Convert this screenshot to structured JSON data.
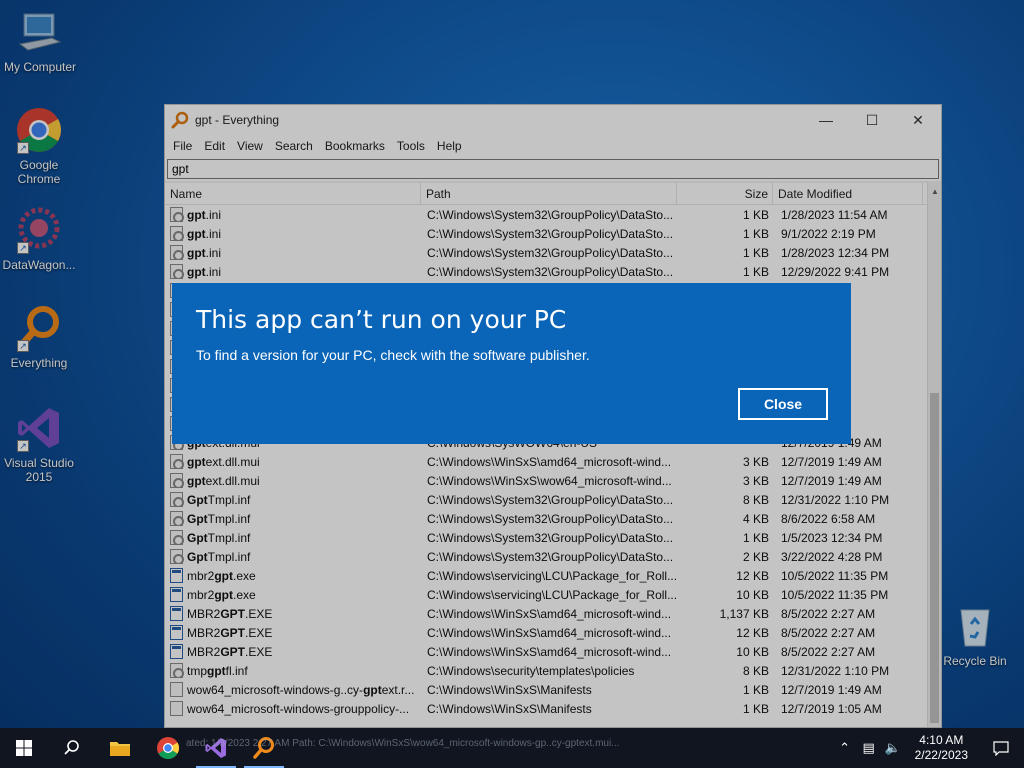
{
  "desktop": {
    "icons": [
      {
        "label": "My Computer"
      },
      {
        "label": "Google Chrome"
      },
      {
        "label": "DataWagon..."
      },
      {
        "label": "Everything"
      },
      {
        "label": "Visual Studio 2015"
      },
      {
        "label": "Recycle Bin"
      }
    ]
  },
  "window": {
    "title": "gpt - Everything",
    "menu": [
      "File",
      "Edit",
      "View",
      "Search",
      "Bookmarks",
      "Tools",
      "Help"
    ],
    "search_value": "gpt",
    "columns": {
      "name": "Name",
      "path": "Path",
      "size": "Size",
      "date": "Date Modified"
    },
    "rows": [
      {
        "pre": "",
        "bold": "gpt",
        "post": ".ini",
        "icon": "gear",
        "path": "C:\\Windows\\System32\\GroupPolicy\\DataSto...",
        "size": "1 KB",
        "date": "1/28/2023 11:54 AM"
      },
      {
        "pre": "",
        "bold": "gpt",
        "post": ".ini",
        "icon": "gear",
        "path": "C:\\Windows\\System32\\GroupPolicy\\DataSto...",
        "size": "1 KB",
        "date": "9/1/2022 2:19 PM"
      },
      {
        "pre": "",
        "bold": "gpt",
        "post": ".ini",
        "icon": "gear",
        "path": "C:\\Windows\\System32\\GroupPolicy\\DataSto...",
        "size": "1 KB",
        "date": "1/28/2023 12:34 PM"
      },
      {
        "pre": "",
        "bold": "gpt",
        "post": ".ini",
        "icon": "gear",
        "path": "C:\\Windows\\System32\\GroupPolicy\\DataSto...",
        "size": "1 KB",
        "date": "12/29/2022 9:41 PM"
      },
      {
        "pre": "",
        "bold": "",
        "post": "",
        "icon": "gear",
        "path": "",
        "size": "",
        "date": "0 PM"
      },
      {
        "pre": "",
        "bold": "",
        "post": "",
        "icon": "gear",
        "path": "",
        "size": "",
        "date": "08 PM"
      },
      {
        "pre": "",
        "bold": "",
        "post": "",
        "icon": "gear",
        "path": "",
        "size": "",
        "date": "08 PM"
      },
      {
        "pre": "",
        "bold": "",
        "post": "",
        "icon": "gear",
        "path": "",
        "size": "",
        "date": "9 AM"
      },
      {
        "pre": "",
        "bold": "",
        "post": "",
        "icon": "gear",
        "path": "",
        "size": "",
        "date": "0 AM"
      },
      {
        "pre": "",
        "bold": "",
        "post": "",
        "icon": "gear",
        "path": "",
        "size": "",
        "date": "8 AM"
      },
      {
        "pre": "",
        "bold": "",
        "post": "",
        "icon": "gear",
        "path": "",
        "size": "",
        "date": "9 AM"
      },
      {
        "pre": "",
        "bold": "",
        "post": "",
        "icon": "gear",
        "path": "",
        "size": "",
        "date": "9 AM"
      },
      {
        "pre": "",
        "bold": "gpt",
        "post": "ext.dll.mui",
        "icon": "gear",
        "path": "C:\\Windows\\SysWOW64\\en-US",
        "size": "",
        "date": "12/7/2019 1:49 AM"
      },
      {
        "pre": "",
        "bold": "gpt",
        "post": "ext.dll.mui",
        "icon": "gear",
        "path": "C:\\Windows\\WinSxS\\amd64_microsoft-wind...",
        "size": "3 KB",
        "date": "12/7/2019 1:49 AM"
      },
      {
        "pre": "",
        "bold": "gpt",
        "post": "ext.dll.mui",
        "icon": "gear",
        "path": "C:\\Windows\\WinSxS\\wow64_microsoft-wind...",
        "size": "3 KB",
        "date": "12/7/2019 1:49 AM"
      },
      {
        "pre": "",
        "bold": "Gpt",
        "post": "Tmpl.inf",
        "icon": "gear",
        "path": "C:\\Windows\\System32\\GroupPolicy\\DataSto...",
        "size": "8 KB",
        "date": "12/31/2022 1:10 PM"
      },
      {
        "pre": "",
        "bold": "Gpt",
        "post": "Tmpl.inf",
        "icon": "gear",
        "path": "C:\\Windows\\System32\\GroupPolicy\\DataSto...",
        "size": "4 KB",
        "date": "8/6/2022 6:58 AM"
      },
      {
        "pre": "",
        "bold": "Gpt",
        "post": "Tmpl.inf",
        "icon": "gear",
        "path": "C:\\Windows\\System32\\GroupPolicy\\DataSto...",
        "size": "1 KB",
        "date": "1/5/2023 12:34 PM"
      },
      {
        "pre": "",
        "bold": "Gpt",
        "post": "Tmpl.inf",
        "icon": "gear",
        "path": "C:\\Windows\\System32\\GroupPolicy\\DataSto...",
        "size": "2 KB",
        "date": "3/22/2022 4:28 PM"
      },
      {
        "pre": "mbr2",
        "bold": "gpt",
        "post": ".exe",
        "icon": "exe",
        "path": "C:\\Windows\\servicing\\LCU\\Package_for_Roll...",
        "size": "12 KB",
        "date": "10/5/2022 11:35 PM"
      },
      {
        "pre": "mbr2",
        "bold": "gpt",
        "post": ".exe",
        "icon": "exe",
        "path": "C:\\Windows\\servicing\\LCU\\Package_for_Roll...",
        "size": "10 KB",
        "date": "10/5/2022 11:35 PM"
      },
      {
        "pre": "MBR2",
        "bold": "GPT",
        "post": ".EXE",
        "icon": "exe",
        "path": "C:\\Windows\\WinSxS\\amd64_microsoft-wind...",
        "size": "1,137 KB",
        "date": "8/5/2022 2:27 AM"
      },
      {
        "pre": "MBR2",
        "bold": "GPT",
        "post": ".EXE",
        "icon": "exe",
        "path": "C:\\Windows\\WinSxS\\amd64_microsoft-wind...",
        "size": "12 KB",
        "date": "8/5/2022 2:27 AM"
      },
      {
        "pre": "MBR2",
        "bold": "GPT",
        "post": ".EXE",
        "icon": "exe",
        "path": "C:\\Windows\\WinSxS\\amd64_microsoft-wind...",
        "size": "10 KB",
        "date": "8/5/2022 2:27 AM"
      },
      {
        "pre": "tmp",
        "bold": "gpt",
        "post": "fl.inf",
        "icon": "gear",
        "path": "C:\\Windows\\security\\templates\\policies",
        "size": "8 KB",
        "date": "12/31/2022 1:10 PM"
      },
      {
        "pre": "wow64_microsoft-windows-g..cy-",
        "bold": "gpt",
        "post": "ext.r...",
        "icon": "file",
        "path": "C:\\Windows\\WinSxS\\Manifests",
        "size": "1 KB",
        "date": "12/7/2019 1:49 AM"
      },
      {
        "pre": "wow64_microsoft-windows-grouppolicy-...",
        "bold": "",
        "post": "",
        "icon": "file",
        "path": "C:\\Windows\\WinSxS\\Manifests",
        "size": "1 KB",
        "date": "12/7/2019 1:05 AM"
      }
    ]
  },
  "dialog": {
    "title": "This app can’t run on your PC",
    "message": "To find a version for your PC, check with the software publisher.",
    "close_label": "Close"
  },
  "taskbar": {
    "preview_text": "ated: 1/3/2023 2:27 AM  Path: C:\\Windows\\WinSxS\\wow64_microsoft-windows-gp..cy-gptext.mui...",
    "time": "4:10 AM",
    "date": "2/22/2023"
  },
  "colors": {
    "dialog_bg": "#0a64b7",
    "taskbar_bg": "#10151f",
    "desktop_bg": "#1565b8"
  }
}
